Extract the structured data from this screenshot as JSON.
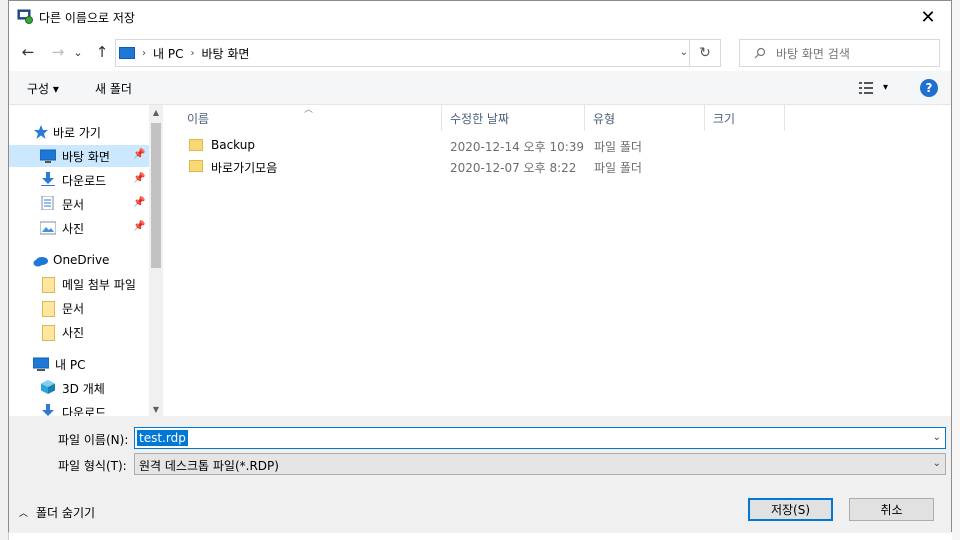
{
  "window": {
    "title": "다른 이름으로 저장",
    "close_glyph": "✕"
  },
  "navigation": {
    "back_glyph": "←",
    "forward_glyph": "→",
    "recent_glyph": "⌄",
    "up_glyph": "↑",
    "breadcrumbs": [
      "내 PC",
      "바탕 화면"
    ],
    "crumb_separator": "›",
    "refresh_glyph": "↻",
    "search_placeholder": "바탕 화면 검색"
  },
  "toolbar": {
    "organize_label": "구성 ▾",
    "new_folder_label": "새 폴더",
    "view_dropdown_glyph": "▾",
    "help_glyph": "?"
  },
  "sidebar": {
    "items": [
      {
        "label": "바로 가기",
        "icon": "star-icon",
        "pinned": false
      },
      {
        "label": "바탕 화면",
        "icon": "desktop-icon",
        "pinned": true,
        "selected": true
      },
      {
        "label": "다운로드",
        "icon": "download-icon",
        "pinned": true
      },
      {
        "label": "문서",
        "icon": "document-icon",
        "pinned": true
      },
      {
        "label": "사진",
        "icon": "picture-icon",
        "pinned": true
      },
      {
        "label": "OneDrive",
        "icon": "cloud-icon",
        "pinned": false
      },
      {
        "label": "메일 첨부 파일",
        "icon": "folder-icon",
        "pinned": false
      },
      {
        "label": "문서",
        "icon": "folder-icon",
        "pinned": false
      },
      {
        "label": "사진",
        "icon": "folder-icon",
        "pinned": false
      },
      {
        "label": "내 PC",
        "icon": "pc-icon",
        "pinned": false
      },
      {
        "label": "3D 개체",
        "icon": "cube-icon",
        "pinned": false
      },
      {
        "label": "다운로드",
        "icon": "download-icon",
        "pinned": false
      }
    ],
    "pin_glyph": "📌"
  },
  "columns": {
    "name": "이름",
    "modified": "수정한 날짜",
    "type": "유형",
    "size": "크기",
    "sort_glyph": "︿"
  },
  "files": [
    {
      "name": "Backup",
      "modified": "2020-12-14 오후 10:39",
      "type": "파일 폴더"
    },
    {
      "name": "바로가기모음",
      "modified": "2020-12-07 오후 8:22",
      "type": "파일 폴더"
    }
  ],
  "form": {
    "filename_label": "파일 이름(N):",
    "filename_value": "test.rdp",
    "filetype_label": "파일 형식(T):",
    "filetype_value": "원격 데스크톱 파일(*.RDP)",
    "dropdown_glyph": "⌄"
  },
  "footer": {
    "hide_folders_label": "폴더 숨기기",
    "hide_chevron": "︿",
    "save_label": "저장(S)",
    "cancel_label": "취소"
  },
  "colors": {
    "accent": "#0078d7",
    "selection": "#cce8ff",
    "folder": "#f8d775"
  }
}
